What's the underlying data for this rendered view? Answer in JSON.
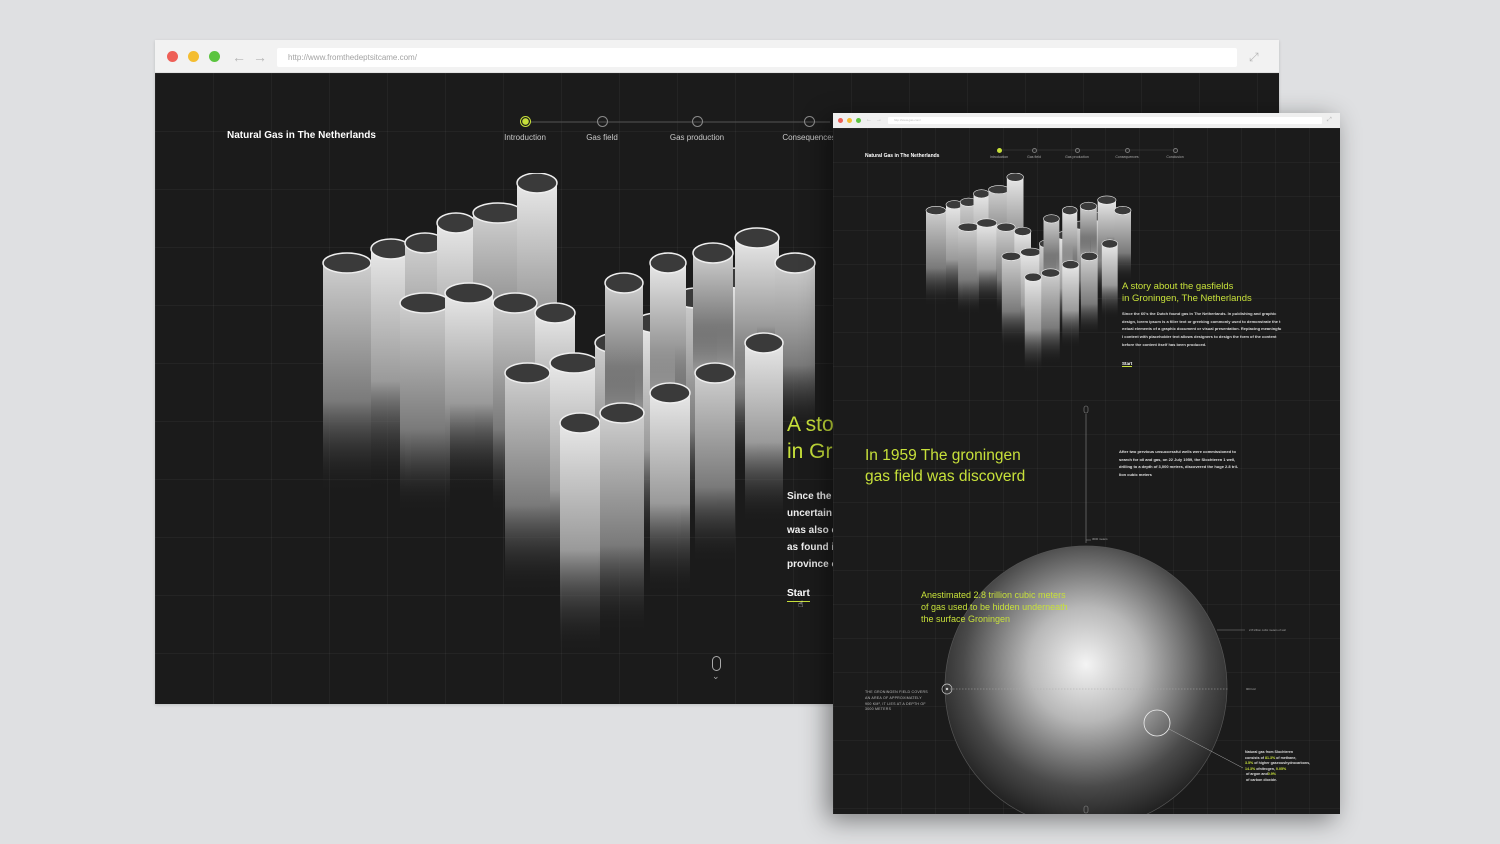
{
  "browser_main": {
    "url": "http://www.fromthedeptsitcame.com/",
    "brand": "Natural Gas in The Netherlands",
    "steps": [
      {
        "label": "Introduction",
        "active": true
      },
      {
        "label": "Gas field",
        "active": false
      },
      {
        "label": "Gas production",
        "active": false
      },
      {
        "label": "Consequences",
        "active": false
      }
    ],
    "headline": "A sto\nin Gr",
    "body": "Since the\nuncertain\nwas also c\nas found i\nprovince o",
    "start_label": "Start"
  },
  "browser_detail": {
    "url": "http://www.gas.com/",
    "brand": "Natural Gas in The Netherlands",
    "steps": [
      {
        "label": "Introduction",
        "active": true
      },
      {
        "label": "Gas field",
        "active": false
      },
      {
        "label": "Gas production",
        "active": false
      },
      {
        "label": "Consequences",
        "active": false
      },
      {
        "label": "Conclusion",
        "active": false
      }
    ],
    "headline": "A story about the gasfields\nin Groningen, The Netherlands",
    "body": "Since the 60's the Dutch found gas in The Netherlands. In publishing and graphic\ndesign, lorem ipsum is a filler text or greeking commonly used to demonstrate the t\nextual elements of a graphic document or visual presentation. Replacing meaningfu\nl content with placeholder text allows designers to design the form of the content\nbefore the content itself has been produced.",
    "start_label": "Start",
    "discovered_heading": "In 1959 The groningen\ngas field was discoverd",
    "discovered_text": "After two previous unsuccessful wells were commissioned to\nsearch for oil and gas, on 22 July 1959, the Slochteren 1 well,\ndrilling to a depth of 3,000 metres, discovered the huge 2.8 tril-\nlion cubic meters",
    "estimate_text": "Anestimated 2.8 trillion cubic meters\nof gas used to be hidden underneath\nthe surface Groningen",
    "field_caption": "THE GRONINGEN FIELD COVERS\nAN AREA OF APPROXIMATELY\n900 KM², IT LIES AT A DEPTH OF\n3000 METERS",
    "composition": [
      {
        "text": "Natural gas from Slochteren",
        "highlight": false
      },
      {
        "text": "consists of ",
        "highlight": false
      },
      {
        "text": "81.3%",
        "highlight": true
      },
      {
        "text": " of methane,",
        "highlight": false
      },
      {
        "text": "3.5%",
        "highlight": true
      },
      {
        "text": " of higher gaseous",
        "highlight": false
      },
      {
        "text": "hydrocarbons, ",
        "highlight": false
      },
      {
        "text": "14.3%",
        "highlight": true
      },
      {
        "text": " of",
        "highlight": false
      },
      {
        "text": "nitrogen, ",
        "highlight": false
      },
      {
        "text": "0.05%",
        "highlight": true
      },
      {
        "text": " of argon and",
        "highlight": false
      },
      {
        "text": "0.9%",
        "highlight": true
      },
      {
        "text": " of carbon dioxide.",
        "highlight": false
      }
    ],
    "tiny_labels": {
      "depth_top": "3000 meters",
      "volume": "2.8 trillion cubic meters of soil",
      "area": "900 km²"
    }
  },
  "colors": {
    "accent": "#c7e03a",
    "page_bg": "#1b1b1b",
    "backdrop": "#dfe0e2"
  },
  "icons": [
    "close-dot",
    "minimize-dot",
    "maximize-dot",
    "back-arrow-icon",
    "forward-arrow-icon",
    "fullscreen-icon",
    "scroll-mouse-icon",
    "chevron-down-icon",
    "cursor-icon"
  ]
}
